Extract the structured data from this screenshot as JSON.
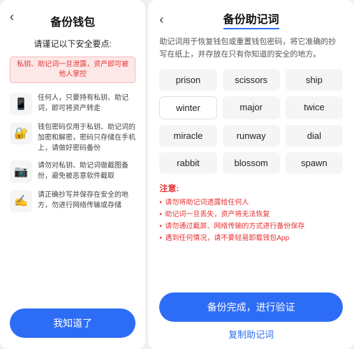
{
  "left": {
    "back_icon": "‹",
    "title": "备份钱包",
    "subtitle": "请谨记以下安全要点:",
    "warning_text": "私钥、助记词一旦泄露，资产即可被他人掌控",
    "safety_items": [
      {
        "icon": "📱",
        "text": "任何人，只要持有私钥、助记词，即可将资产转走"
      },
      {
        "icon": "🔐",
        "text": "钱包密码仅用于私钥、助记词的加密和解密，密码只存储在手机上，请做好密码备份"
      },
      {
        "icon": "📷",
        "text": "请勿对私钥、助记词做截图备份，避免被恶意软件截取"
      },
      {
        "icon": "✍️",
        "text": "请正确抄写并保存在安全的地方，勿进行网络传输或存储"
      }
    ],
    "confirm_btn": "我知道了"
  },
  "right": {
    "back_icon": "‹",
    "title": "备份助记词",
    "description": "助记词用于恢复钱包或重置钱包密码，将它准确的抄写在纸上，并存放在只有你知道的安全的地方。",
    "mnemonic_words": [
      "prison",
      "scissors",
      "ship",
      "winter",
      "major",
      "twice",
      "miracle",
      "runway",
      "dial",
      "rabbit",
      "blossom",
      "spawn"
    ],
    "notes_title": "注意:",
    "notes": [
      "请勿将助记词透露给任何人",
      "助记词一旦丢失，资产将无法恢复",
      "请勿通过截屏、网络传输的方式进行备份保存",
      "遇到任何情况，请不要轻易卸载钱包App"
    ],
    "confirm_btn": "备份完成，进行验证",
    "copy_btn": "复制助记词"
  }
}
